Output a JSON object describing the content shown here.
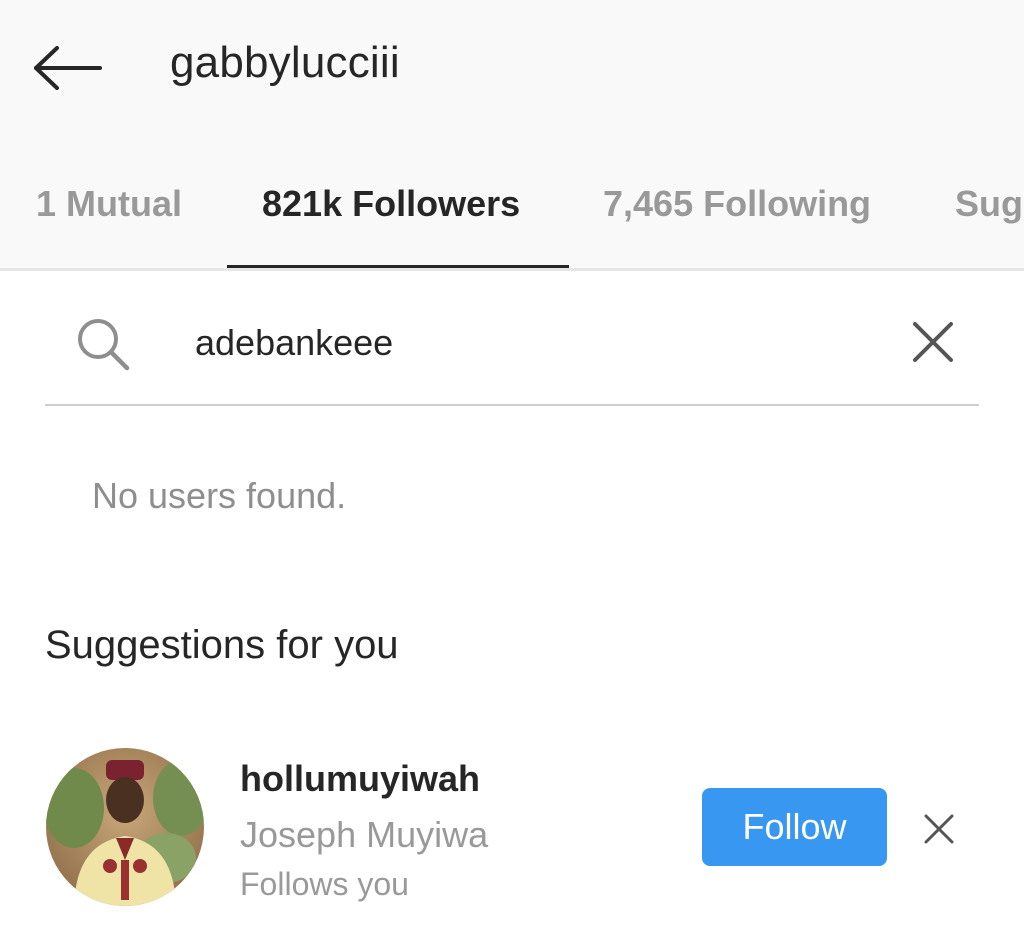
{
  "header": {
    "title": "gabbylucciii",
    "back_icon": "arrow-left-icon"
  },
  "tabs": [
    {
      "label": "1 Mutual",
      "active": false
    },
    {
      "label": "821k Followers",
      "active": true
    },
    {
      "label": "7,465 Following",
      "active": false
    },
    {
      "label": "Sug",
      "active": false
    }
  ],
  "search": {
    "icon": "search-icon",
    "value": "adebankeee",
    "clear_icon": "close-icon"
  },
  "results": {
    "empty_text": "No users found."
  },
  "suggestions": {
    "title": "Suggestions for you",
    "items": [
      {
        "username": "hollumuyiwah",
        "full_name": "Joseph Muyiwa",
        "subtext": "Follows you",
        "follow_label": "Follow",
        "dismiss_icon": "close-icon"
      }
    ]
  },
  "colors": {
    "accent": "#3897f0",
    "header_bg": "#f9f9f9",
    "text_primary": "#262626",
    "text_secondary": "#999999"
  }
}
